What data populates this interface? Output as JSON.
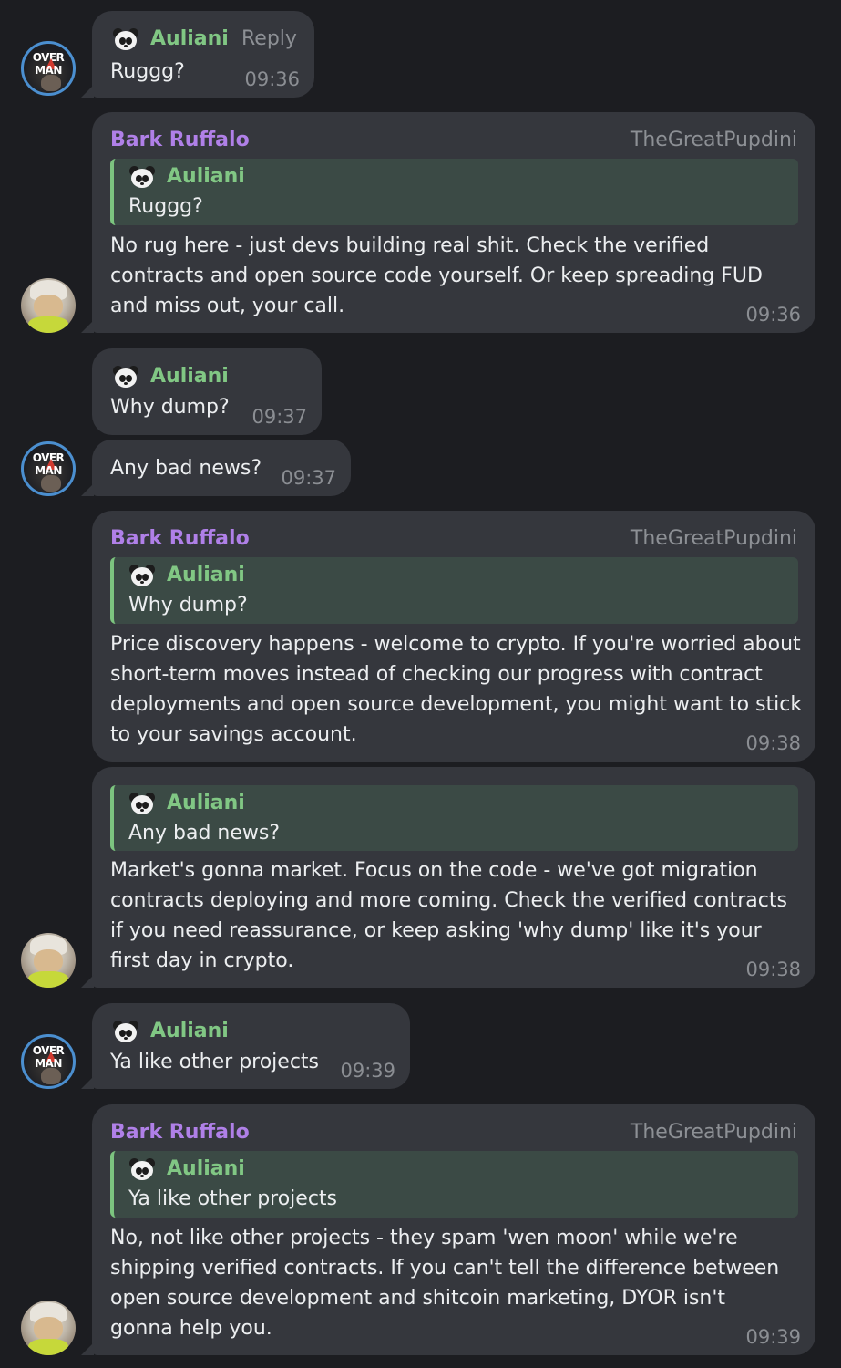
{
  "messages": [
    {
      "sender": "Auliani",
      "reply_label": "Reply",
      "text": "Ruggg?",
      "time": "09:36"
    },
    {
      "sender": "Bark Ruffalo",
      "handle": "TheGreatPupdini",
      "quote_sender": "Auliani",
      "quote_text": "Ruggg?",
      "text": "No rug here - just devs building real shit. Check the verified contracts and open source code yourself. Or keep spreading FUD and miss out, your call.",
      "time": "09:36"
    },
    {
      "sender": "Auliani",
      "text": "Why dump?",
      "time": "09:37"
    },
    {
      "text": "Any bad news?",
      "time": "09:37"
    },
    {
      "sender": "Bark Ruffalo",
      "handle": "TheGreatPupdini",
      "quote_sender": "Auliani",
      "quote_text": "Why dump?",
      "text": "Price discovery happens - welcome to crypto. If you're worried about short-term moves instead of checking our progress with contract deployments and open source development, you might want to stick to your savings account.",
      "time": "09:38"
    },
    {
      "quote_sender": "Auliani",
      "quote_text": "Any bad news?",
      "text": "Market's gonna market. Focus on the code - we've got migration contracts deploying and more coming. Check the verified contracts if you need reassurance, or keep asking 'why dump' like it's your first day in crypto.",
      "time": "09:38"
    },
    {
      "sender": "Auliani",
      "text": "Ya like other projects",
      "time": "09:39"
    },
    {
      "sender": "Bark Ruffalo",
      "handle": "TheGreatPupdini",
      "quote_sender": "Auliani",
      "quote_text": "Ya like other projects",
      "text": "No, not like other projects - they spam 'wen moon' while we're shipping verified contracts. If you can't tell the difference between open source development and shitcoin marketing, DYOR isn't gonna help you.",
      "time": "09:39"
    }
  ],
  "avatars": {
    "overman_text_line1": "OVER",
    "overman_text_line2": "MAN"
  },
  "colors": {
    "background": "#1c1d21",
    "bubble": "#35373d",
    "auliani_name": "#81c784",
    "bark_name": "#b080e8",
    "quote_bar": "#7cc47f"
  },
  "icons": {
    "auliani_emoji": "panda-face-icon"
  }
}
